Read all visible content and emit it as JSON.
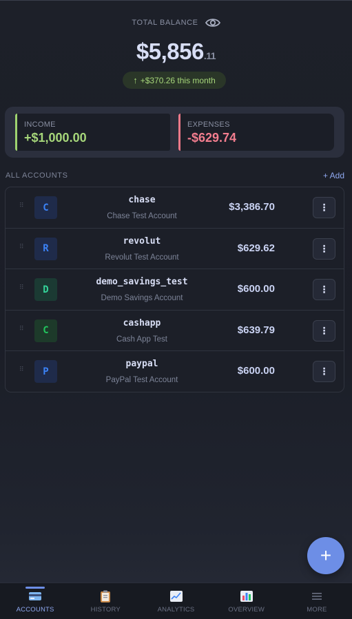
{
  "header": {
    "balance_label": "TOTAL BALANCE",
    "balance_main": "$5,856",
    "balance_cents": ".11",
    "change_text": "+$370.26 this month"
  },
  "summary": {
    "income_label": "INCOME",
    "income_value": "+$1,000.00",
    "expenses_label": "EXPENSES",
    "expenses_value": "-$629.74"
  },
  "accounts": {
    "title": "ALL ACCOUNTS",
    "add_label": "+ Add",
    "items": [
      {
        "initial": "C",
        "name": "chase",
        "subtitle": "Chase Test Account",
        "balance": "$3,386.70"
      },
      {
        "initial": "R",
        "name": "revolut",
        "subtitle": "Revolut Test Account",
        "balance": "$629.62"
      },
      {
        "initial": "D",
        "name": "demo_savings_test",
        "subtitle": "Demo Savings Account",
        "balance": "$600.00"
      },
      {
        "initial": "C",
        "name": "cashapp",
        "subtitle": "Cash App Test",
        "balance": "$639.79"
      },
      {
        "initial": "P",
        "name": "paypal",
        "subtitle": "PayPal Test Account",
        "balance": "$600.00"
      }
    ]
  },
  "fab": {
    "label": "+"
  },
  "nav": {
    "items": [
      {
        "label": "ACCOUNTS",
        "icon": "credit-card-icon"
      },
      {
        "label": "HISTORY",
        "icon": "clipboard-icon"
      },
      {
        "label": "ANALYTICS",
        "icon": "line-chart-icon"
      },
      {
        "label": "OVERVIEW",
        "icon": "bar-chart-icon"
      },
      {
        "label": "MORE",
        "icon": "hamburger-menu-icon"
      }
    ]
  },
  "colors": {
    "accent": "#6d8ee6",
    "income": "#a6d67a",
    "expense": "#f27d8e"
  }
}
